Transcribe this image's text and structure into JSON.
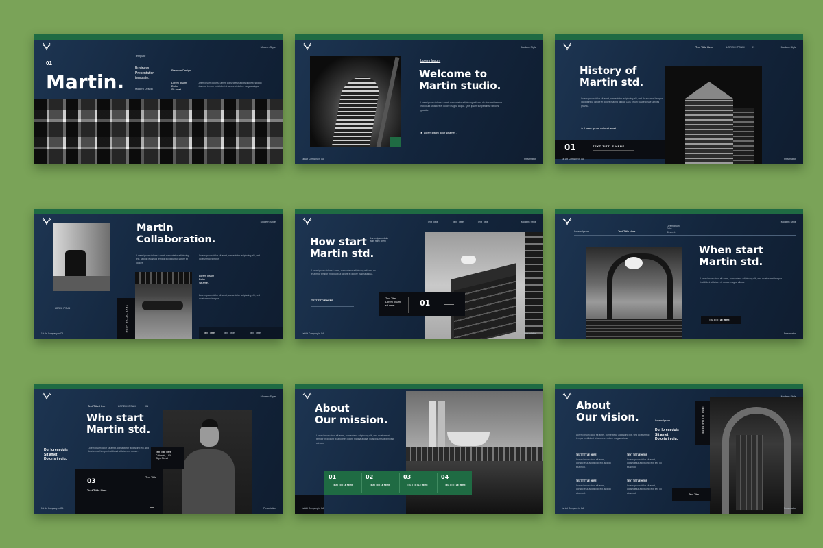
{
  "slides": {
    "s1": {
      "top_right": "Modern Style",
      "number": "01",
      "title": "Martin.",
      "col1_head": "Template",
      "col1_lines": "Business\nPresentation\ntemplate.",
      "col1_foot": "Modern Design",
      "col2_head": "Premium Design",
      "col2_lines": "Lorem Ipsum\nDolor\nSit amet.",
      "para": "Lorem ipsum dolor sit amet, consectetur adipiscing elit, sed do eiusmod tempor incididunt ut labore et dolore magna aliqua."
    },
    "s2": {
      "top_right": "Modern Style",
      "kicker": "Lorem Ipsum",
      "title": "Welcome to\nMartin studio.",
      "para": "Lorem ipsum dolor sit amet, consectetur adipiscing elit, sed do eiusmod tempor incididunt ut labore et dolore magna aliqua. Quis ipsum suspendisse ultrices gravida.",
      "bullet": "Lorem ipsum dolor sit amet .",
      "footer_left": "1st Art Company in CA",
      "footer_right": "Presentation"
    },
    "s3": {
      "nav1": "Text Tittle Here",
      "nav2": "LOREM IPSUM",
      "nav3": "01",
      "top_right": "Modern Style",
      "title": "History of\nMartin std.",
      "para": "Lorem ipsum dolor sit amet, consectetur adipiscing elit, sed do eiusmod tempor incididunt ut labore et dolore magna aliqua. Quis ipsum suspendisse ultrices gravida.",
      "bullet": "Lorem Ipsum dolor sit amet .",
      "number": "01",
      "box_title": "TEXT TITTLE HERE",
      "footer_left": "1st Art Company in CA",
      "footer_right": "Presentation"
    },
    "s4": {
      "top_right": "Modern Style",
      "title": "Martin\nCollaboration.",
      "para": "Lorem ipsum dolor sit amet, consectetur adipiscing elit, sed do eiusmod tempor incididunt ut labore et dolore.",
      "para2": "Lorem ipsum dolor sit amet, consectetur adipiscing elit, sed do eiusmod tempor.",
      "side_lines": "Lorem Ipsum\nDolor\nSit amet.",
      "lorem_ipsum": "LOREM IPSUM",
      "vertical": "TEXT TITTLE HERE",
      "footer_left": "1st Art Company in CA",
      "tab1": "Text Tittle",
      "tab2": "Text Tittle",
      "tab3": "Text Tittle"
    },
    "s5": {
      "nav1": "Text Tittle",
      "nav2": "Text Tittle",
      "nav3": "Text Tittle",
      "top_right": "Modern Style",
      "side_lines": "Lorem ipsum dolor\nsunt nunc lorem",
      "title": "How start\nMartin std.",
      "para": "Lorem ipsum dolor sit amet, consectetur adipiscing elit, sed do eiusmod tempor incididunt ut labore et dolore magna aliqua.",
      "text_title": "TEXT TITTLE HERE",
      "box_lines": "Text Title\nLorem ipsum\nsit amet.",
      "number": "01",
      "footer_left": "1st Art Company in CA",
      "footer_right": "Presentation"
    },
    "s6": {
      "nav1": "Lorem Ipsum",
      "nav2": "Text Tittle Here",
      "nav3": "Lorem Ipsum\nDolor\nSit amet.",
      "top_right": "Modern Style",
      "title": "When start\nMartin std.",
      "para": "Lorem ipsum dolor sit amet, consectetur adipiscing elit, sed do eiusmod tempor incididunt ut labore et dolore magna aliqua.",
      "button": "TEXT TITTLE HERE",
      "footer_right": "Presentation"
    },
    "s7": {
      "nav1": "Text Tittle Here",
      "nav2": "LOREM IPSUM",
      "nav3": "01",
      "top_right": "Modern Style",
      "title": "Who start\nMartin std.",
      "side": "Dui lorem duis\nSit amet\nDoloris in ciu.",
      "para": "Lorem ipsum dolor sit amet, consectetur adipiscing elit, sed do eiusmod tempor incididunt ut labore et dolore.",
      "card_lines": "Text Tittle Here\nCalifornia, USA\nCityu Street",
      "number": "03",
      "box_title": "Text Tittle Here",
      "box_right": "Text Tittle",
      "footer_left": "1st Art Company in CA",
      "footer_right": "Presentation"
    },
    "s8": {
      "title": "About\nOur mission.",
      "para": "Lorem ipsum dolor sit amet, consectetur adipiscing elit, sed do eiusmod tempor incididunt ut labore et dolore magna aliqua. Quis ipsum suspendisse ultrices.",
      "steps": [
        {
          "n": "01",
          "t": "TEXT TITTLE HERE"
        },
        {
          "n": "02",
          "t": "TEXT TITTLE HERE"
        },
        {
          "n": "03",
          "t": "TEXT TITTLE HERE"
        },
        {
          "n": "04",
          "t": "TEXT TITTLE HERE"
        }
      ],
      "footer_left": "1st Art Company in CA"
    },
    "s9": {
      "top_right": "Modern Style",
      "title": "About\nOur vision.",
      "kicker": "Lorem Ipsum",
      "side": "Dui lorem duis\nSit amet\nDoloris in ciu.",
      "para": "Lorem ipsum dolor sit amet, consectetur adipiscing elit, sed do eiusmod tempor incididunt ut labore et dolore magna aliqua.",
      "items": [
        "TEXT TITTLE HERE",
        "TEXT TITTLE HERE",
        "TEXT TITTLE HERE",
        "TEXT TITTLE HERE"
      ],
      "item_para": "Lorem ipsum dolor sit amet, consectetur adipiscing elit, sed do eiusmod.",
      "vertical": "TEXT TITTLE HERE",
      "box": "Text Title",
      "footer_left": "1st Art Company in CA",
      "footer_right": "Presentation"
    }
  }
}
